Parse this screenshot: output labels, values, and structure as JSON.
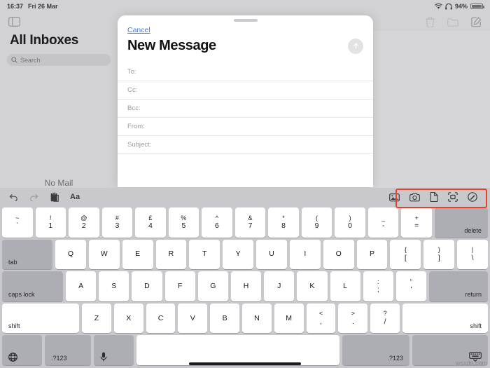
{
  "status_bar": {
    "time": "16:37",
    "date": "Fri 26 Mar",
    "battery_percent": "94%",
    "wifi_icon": "wifi-icon",
    "headphones_icon": "headphones-icon"
  },
  "mail_toolbar": {
    "sidebar_toggle_icon": "sidebar-toggle-icon",
    "trash_icon": "trash-icon",
    "folder_icon": "folder-icon",
    "compose_icon": "compose-icon"
  },
  "sidebar": {
    "title": "All Inboxes",
    "search_placeholder": "Search",
    "search_icon": "search-icon",
    "empty_state": "No Mail"
  },
  "compose_sheet": {
    "cancel_label": "Cancel",
    "title": "New Message",
    "send_icon": "send-arrow-up-icon",
    "fields": [
      {
        "label": "To:",
        "value": ""
      },
      {
        "label": "Cc:",
        "value": ""
      },
      {
        "label": "Bcc:",
        "value": ""
      },
      {
        "label": "From:",
        "value": ""
      },
      {
        "label": "Subject:",
        "value": ""
      }
    ]
  },
  "keyboard_accessory": {
    "undo_icon": "undo-icon",
    "redo_icon": "redo-icon",
    "paste_icon": "paste-clipboard-icon",
    "format_label": "Aa",
    "attachment_tools": [
      {
        "name": "photo-library-icon"
      },
      {
        "name": "camera-icon"
      },
      {
        "name": "document-icon"
      },
      {
        "name": "scan-document-icon"
      },
      {
        "name": "markup-pen-icon"
      }
    ],
    "highlight_color": "#e8402a"
  },
  "keyboard": {
    "rows": [
      {
        "name": "number-row",
        "keys": [
          {
            "top": "~",
            "bottom": "`",
            "style": "dual"
          },
          {
            "top": "!",
            "bottom": "1",
            "style": "dual"
          },
          {
            "top": "@",
            "bottom": "2",
            "style": "dual"
          },
          {
            "top": "#",
            "bottom": "3",
            "style": "dual"
          },
          {
            "top": "£",
            "bottom": "4",
            "style": "dual"
          },
          {
            "top": "%",
            "bottom": "5",
            "style": "dual"
          },
          {
            "top": "^",
            "bottom": "6",
            "style": "dual"
          },
          {
            "top": "&",
            "bottom": "7",
            "style": "dual"
          },
          {
            "top": "*",
            "bottom": "8",
            "style": "dual"
          },
          {
            "top": "(",
            "bottom": "9",
            "style": "dual"
          },
          {
            "top": ")",
            "bottom": "0",
            "style": "dual"
          },
          {
            "top": "_",
            "bottom": "-",
            "style": "dual"
          },
          {
            "top": "+",
            "bottom": "=",
            "style": "dual"
          },
          {
            "label": "delete",
            "style": "wide-del dark lbl-right"
          }
        ]
      },
      {
        "name": "qwerty-row",
        "keys": [
          {
            "label": "tab",
            "style": "wide-tab dark lbl-left"
          },
          {
            "label": "Q"
          },
          {
            "label": "W"
          },
          {
            "label": "E"
          },
          {
            "label": "R"
          },
          {
            "label": "T"
          },
          {
            "label": "Y"
          },
          {
            "label": "U"
          },
          {
            "label": "I"
          },
          {
            "label": "O"
          },
          {
            "label": "P"
          },
          {
            "top": "{",
            "bottom": "[",
            "style": "dual"
          },
          {
            "top": "}",
            "bottom": "]",
            "style": "dual"
          },
          {
            "top": "|",
            "bottom": "\\",
            "style": "dual"
          }
        ]
      },
      {
        "name": "home-row",
        "keys": [
          {
            "label": "caps lock",
            "style": "wide-caps dark lbl-left"
          },
          {
            "label": "A"
          },
          {
            "label": "S"
          },
          {
            "label": "D"
          },
          {
            "label": "F"
          },
          {
            "label": "G"
          },
          {
            "label": "H"
          },
          {
            "label": "J"
          },
          {
            "label": "K"
          },
          {
            "label": "L"
          },
          {
            "top": ":",
            "bottom": ";",
            "style": "dual"
          },
          {
            "top": "\"",
            "bottom": "'",
            "style": "dual"
          },
          {
            "label": "return",
            "style": "wide-ret dark lbl-right"
          }
        ]
      },
      {
        "name": "shift-row",
        "keys": [
          {
            "label": "shift",
            "style": "wide-shiftL lbl-left"
          },
          {
            "label": "Z"
          },
          {
            "label": "X"
          },
          {
            "label": "C"
          },
          {
            "label": "V"
          },
          {
            "label": "B"
          },
          {
            "label": "N"
          },
          {
            "label": "M"
          },
          {
            "top": "<",
            "bottom": ",",
            "style": "dual"
          },
          {
            "top": ">",
            "bottom": ".",
            "style": "dual"
          },
          {
            "top": "?",
            "bottom": "/",
            "style": "dual"
          },
          {
            "label": "shift",
            "style": "wide-shiftR lbl-right"
          }
        ]
      },
      {
        "name": "bottom-row",
        "keys": [
          {
            "icon": "globe-icon",
            "style": "bottom-sm dark lbl-left"
          },
          {
            "label": ".?123",
            "style": "bottom-num dark lbl-left"
          },
          {
            "icon": "microphone-icon",
            "style": "bottom-sm dark lbl-left"
          },
          {
            "label": "",
            "style": "space"
          },
          {
            "label": ".?123",
            "style": "num-right dark lbl-right"
          },
          {
            "icon": "dismiss-keyboard-icon",
            "style": "dismiss dark lbl-right"
          }
        ]
      }
    ]
  },
  "watermark": "wsxdn.com"
}
